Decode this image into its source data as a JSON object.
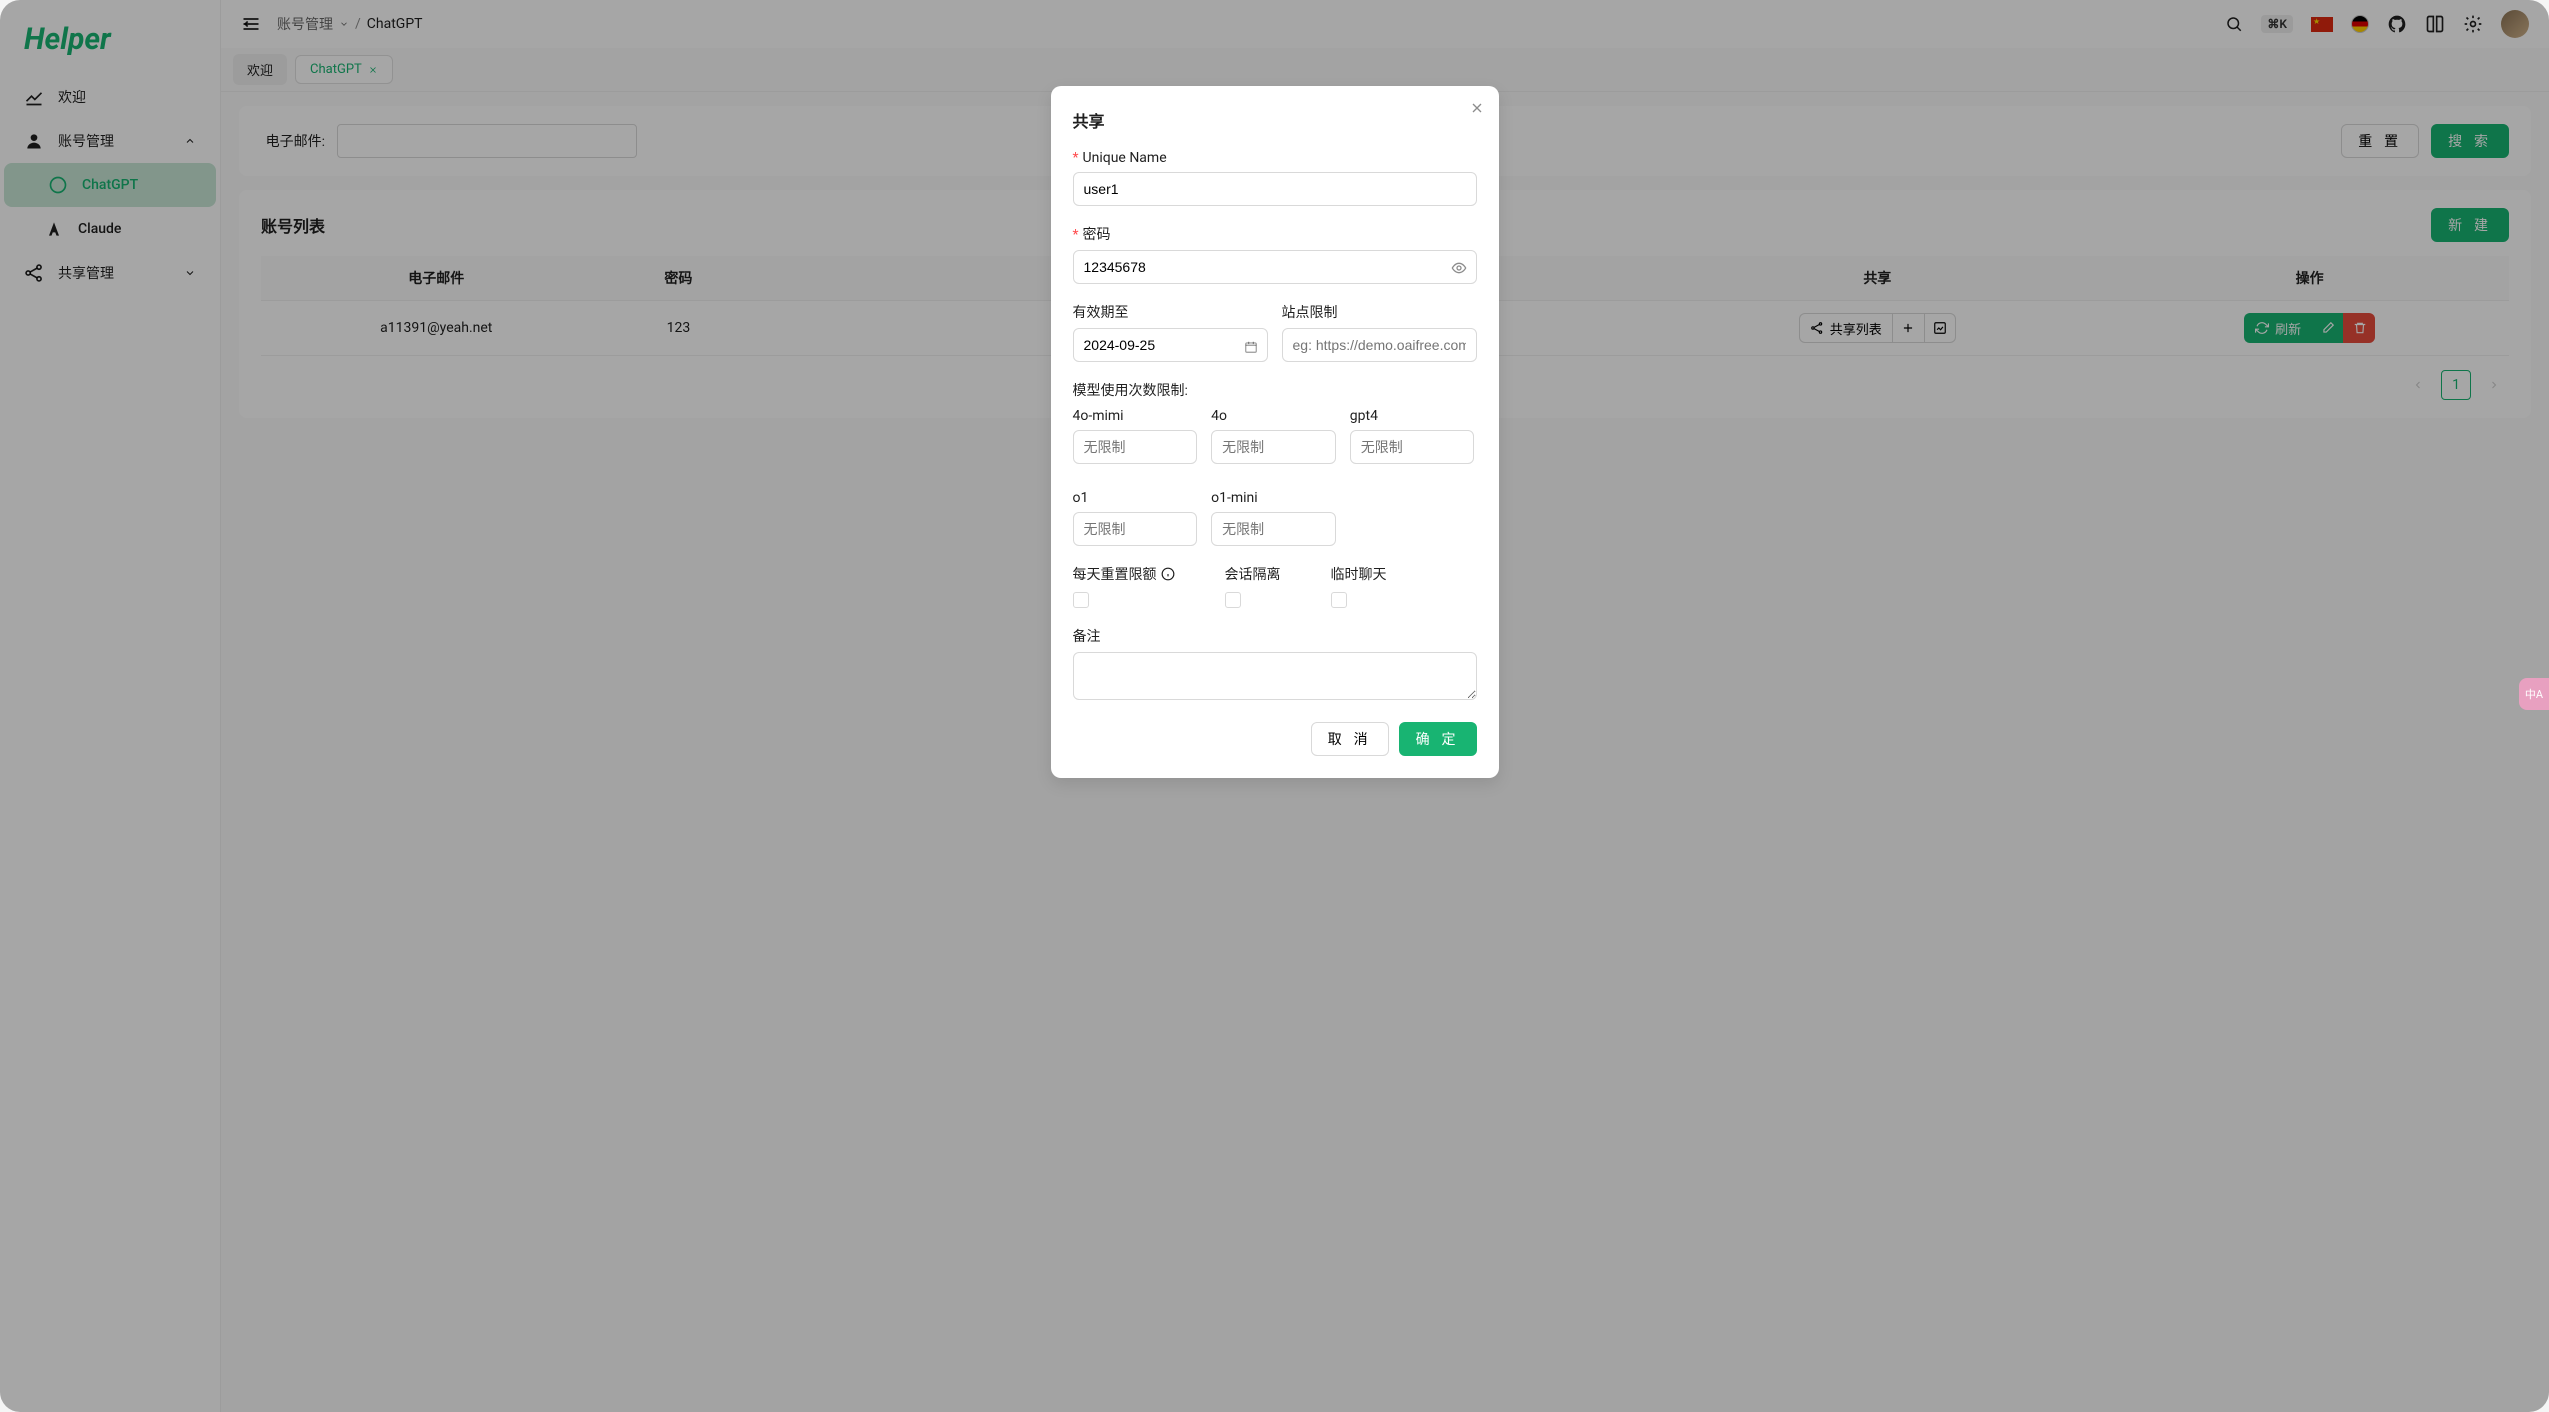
{
  "logo": "Helper",
  "sidebar": {
    "welcome": "欢迎",
    "account": "账号管理",
    "chatgpt": "ChatGPT",
    "claude": "Claude",
    "share": "共享管理"
  },
  "breadcrumb": {
    "parent": "账号管理",
    "current": "ChatGPT"
  },
  "topbar": {
    "kbd": "⌘K"
  },
  "tabs": {
    "welcome": "欢迎",
    "chatgpt": "ChatGPT"
  },
  "filter": {
    "email_label": "电子邮件:",
    "reset": "重 置",
    "search": "搜 索"
  },
  "list": {
    "title": "账号列表",
    "new": "新 建",
    "columns": {
      "email": "电子邮件",
      "password": "密码",
      "share": "共享",
      "action": "操作"
    },
    "share_list": "共享列表",
    "refresh": "刷新",
    "rows": [
      {
        "email": "a11391@yeah.net",
        "password": "123"
      }
    ],
    "page": "1"
  },
  "modal": {
    "title": "共享",
    "unique_name_label": "Unique Name",
    "unique_name_value": "user1",
    "password_label": "密码",
    "password_value": "12345678",
    "expire_label": "有效期至",
    "expire_value": "2024-09-25",
    "site_label": "站点限制",
    "site_placeholder": "eg: https://demo.oaifree.com",
    "model_label": "模型使用次数限制:",
    "models": {
      "m4o_mini": {
        "label": "4o-mimi",
        "placeholder": "无限制"
      },
      "m4o": {
        "label": "4o",
        "placeholder": "无限制"
      },
      "gpt4": {
        "label": "gpt4",
        "placeholder": "无限制"
      },
      "o1": {
        "label": "o1",
        "placeholder": "无限制"
      },
      "o1_mini": {
        "label": "o1-mini",
        "placeholder": "无限制"
      }
    },
    "reset_quota": "每天重置限额",
    "isolate": "会话隔离",
    "temp_chat": "临时聊天",
    "remark": "备注",
    "cancel": "取 消",
    "ok": "确 定"
  },
  "lang_fab": "中A"
}
